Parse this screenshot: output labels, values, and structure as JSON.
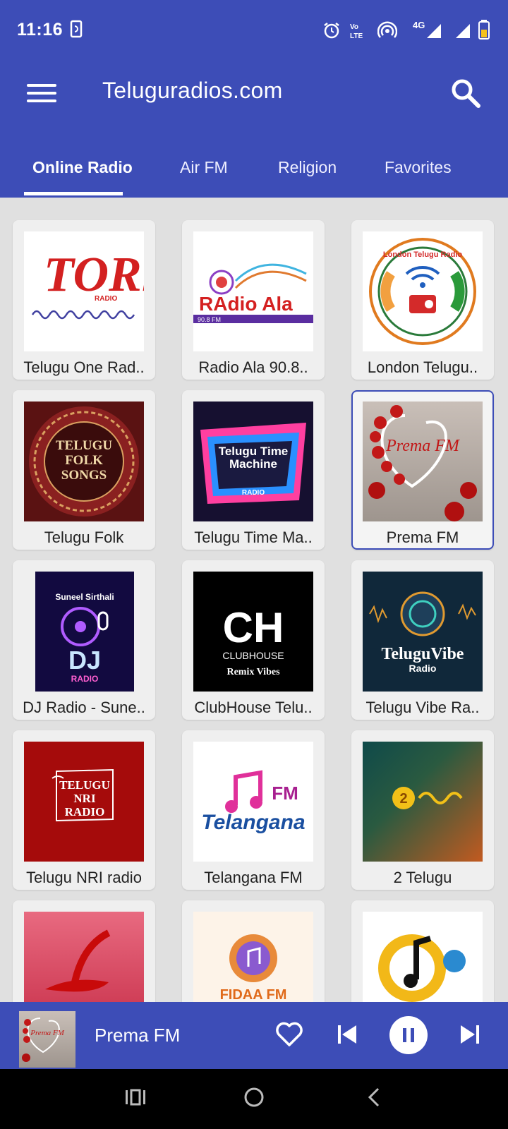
{
  "status": {
    "time": "11:16",
    "network": "4G"
  },
  "app": {
    "title": "Teluguradios.com"
  },
  "tabs": [
    {
      "label": "Online Radio",
      "active": true
    },
    {
      "label": "Air FM"
    },
    {
      "label": "Religion"
    },
    {
      "label": "Favorites"
    }
  ],
  "stations": [
    {
      "name": "Telugu One Rad..",
      "logo_text": "TORi",
      "logo_sub": "RADIO"
    },
    {
      "name": "Radio Ala 90.8..",
      "logo_text": "RAdio Ala",
      "logo_sub": "90.8 FM"
    },
    {
      "name": "London Telugu..",
      "logo_text": "London Telugu Radio",
      "logo_sub": ""
    },
    {
      "name": "Telugu Folk",
      "logo_text": "TELUGU FOLK SONGS",
      "logo_sub": ""
    },
    {
      "name": "Telugu Time Ma..",
      "logo_text": "Telugu Time Machine",
      "logo_sub": "RADIO"
    },
    {
      "name": "Prema FM",
      "logo_text": "Prema FM",
      "logo_sub": ""
    },
    {
      "name": "DJ Radio - Sune..",
      "logo_text": "DJ",
      "logo_sub": "RADIO",
      "logo_top": "Suneel Sirthali"
    },
    {
      "name": "ClubHouse Telu..",
      "logo_text": "CH",
      "logo_sub": "CLUBHOUSE",
      "logo_top": "Remix Vibes"
    },
    {
      "name": "Telugu Vibe Ra..",
      "logo_text": "TeluguVibe",
      "logo_sub": "Radio"
    },
    {
      "name": "Telugu NRI radio",
      "logo_text": "TELUGU NRI RADIO",
      "logo_sub": ""
    },
    {
      "name": "Telangana FM",
      "logo_text": "Telangana",
      "logo_sub": "FM"
    },
    {
      "name": "2 Telugu",
      "logo_text": "2",
      "logo_sub": ""
    },
    {
      "name": "",
      "logo_text": "",
      "logo_sub": ""
    },
    {
      "name": "",
      "logo_text": "FIDAA FM",
      "logo_sub": ""
    },
    {
      "name": "",
      "logo_text": "",
      "logo_sub": ""
    }
  ],
  "player": {
    "title": "Prema FM",
    "thumb_text": "Prema FM"
  },
  "colors": {
    "primary": "#3d4db7",
    "card": "#efefef",
    "background": "#e0e0e0"
  }
}
